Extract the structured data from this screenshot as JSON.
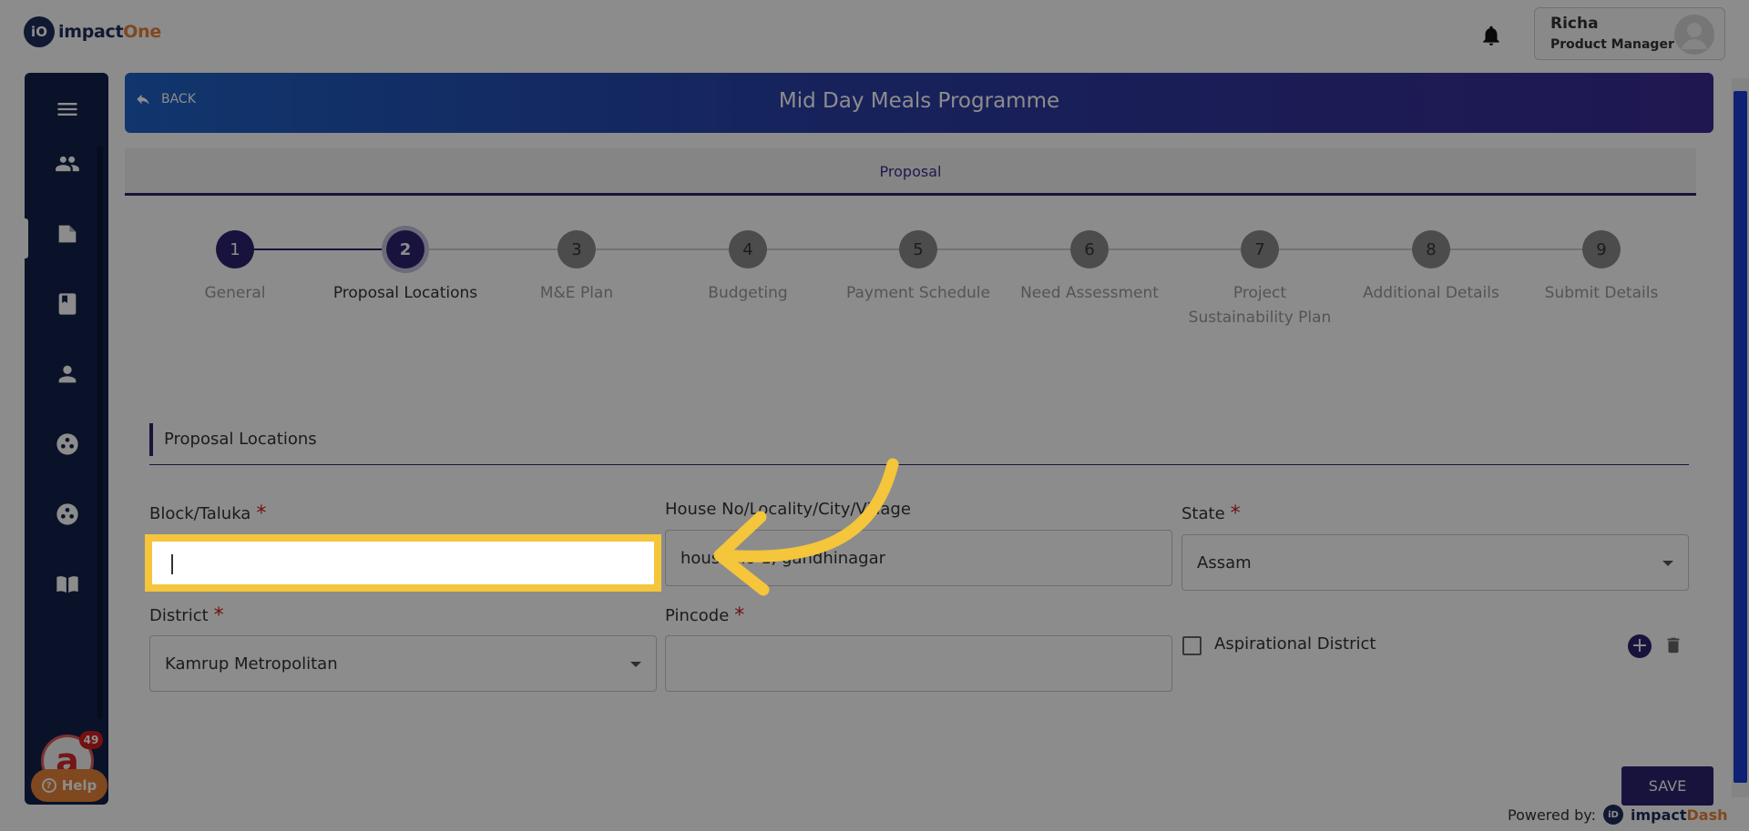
{
  "app": {
    "logo_prefix": "iO",
    "logo_main": "impact",
    "logo_accent": "One"
  },
  "user": {
    "name": "Richa",
    "role": "Product Manager"
  },
  "sidebar": {
    "icons": [
      "menu-icon",
      "people-icon",
      "folder-icon",
      "book-icon",
      "person-icon",
      "group-icon",
      "group-alt-icon",
      "open-book-icon"
    ],
    "notification_count": "49",
    "help_label": "Help"
  },
  "page": {
    "back_label": "BACK",
    "title": "Mid Day Meals Programme",
    "tab": "Proposal"
  },
  "stepper": {
    "current_step": 2,
    "steps": [
      {
        "number": "1",
        "label": "General"
      },
      {
        "number": "2",
        "label": "Proposal Locations"
      },
      {
        "number": "3",
        "label": "M&E Plan"
      },
      {
        "number": "4",
        "label": "Budgeting"
      },
      {
        "number": "5",
        "label": "Payment Schedule"
      },
      {
        "number": "6",
        "label": "Need Assessment"
      },
      {
        "number": "7",
        "label": "Project Sustainability Plan"
      },
      {
        "number": "8",
        "label": "Additional Details"
      },
      {
        "number": "9",
        "label": "Submit Details"
      }
    ]
  },
  "form": {
    "section_title": "Proposal Locations",
    "block_label": "Block/Taluka",
    "block_value": "",
    "house_label": "House No/Locality/City/Village",
    "house_value": "house no 1, gandhinagar",
    "state_label": "State",
    "state_value": "Assam",
    "district_label": "District",
    "district_value": "Kamrup Metropolitan",
    "pincode_label": "Pincode",
    "pincode_value": "",
    "aspirational_label": "Aspirational District",
    "aspirational_checked": false
  },
  "footer": {
    "save_label": "SAVE",
    "powered_label": "Powered by:",
    "powered_brand_main": "impact",
    "powered_brand_accent": "Dash",
    "powered_logo": "iD"
  },
  "colors": {
    "brand_navy": "#1f2c5c",
    "brand_orange": "#e8833a",
    "primary": "#2c2370",
    "highlight": "#f5c53b",
    "required": "#d11e1e"
  }
}
